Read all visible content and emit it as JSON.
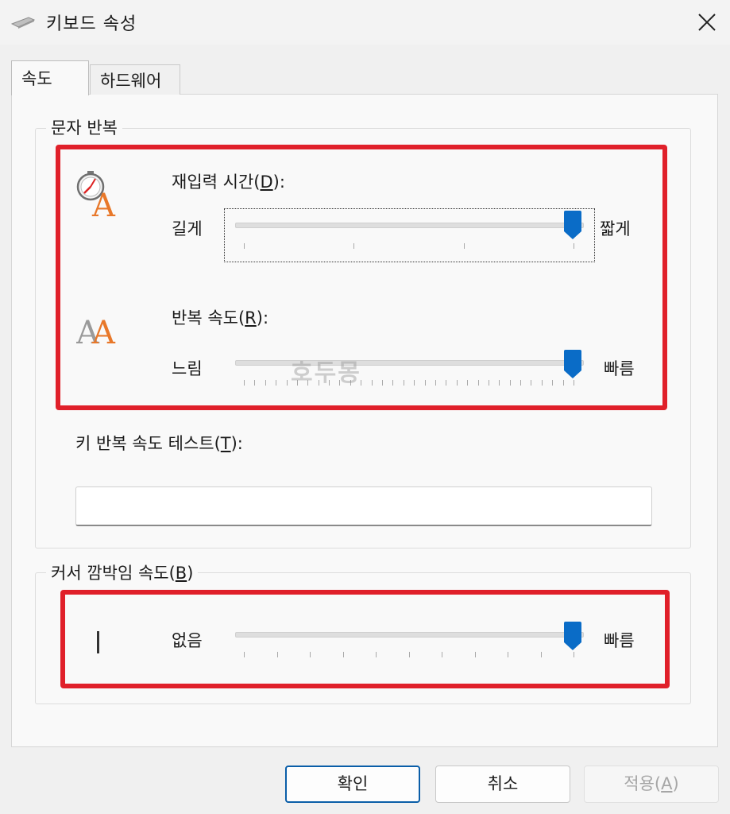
{
  "window": {
    "title": "키보드 속성",
    "close_icon": "close-icon"
  },
  "tabs": [
    {
      "label": "속도",
      "selected": true
    },
    {
      "label": "하드웨어",
      "selected": false
    }
  ],
  "char_repeat": {
    "legend": "문자 반복",
    "delay": {
      "label_prefix": "재입력 시간(",
      "mnemonic": "D",
      "label_suffix": "):",
      "min_label": "길게",
      "max_label": "짧게",
      "value_fraction": 1.0,
      "tick_count": 4,
      "icon": "stopwatch-letter-a-icon"
    },
    "rate": {
      "label_prefix": "반복 속도(",
      "mnemonic": "R",
      "label_suffix": "):",
      "min_label": "느림",
      "max_label": "빠름",
      "value_fraction": 1.0,
      "tick_count": 32,
      "icon": "double-letter-a-icon"
    },
    "test": {
      "label_prefix": "키 반복 속도 테스트(",
      "mnemonic": "T",
      "label_suffix": "):",
      "value": ""
    }
  },
  "cursor_blink": {
    "legend_prefix": "커서 깜박임 속도(",
    "mnemonic": "B",
    "legend_suffix": ")",
    "min_label": "없음",
    "max_label": "빠름",
    "value_fraction": 1.0,
    "tick_count": 11,
    "icon": "text-cursor-icon"
  },
  "buttons": {
    "ok": "확인",
    "cancel": "취소",
    "apply_prefix": "적용(",
    "apply_mnemonic": "A",
    "apply_suffix": ")"
  },
  "watermark": "호두몽",
  "colors": {
    "accent": "#0a6cc7",
    "highlight": "#e0202a",
    "glyph_orange": "#e8782a",
    "glyph_gray": "#9a9a9a"
  }
}
